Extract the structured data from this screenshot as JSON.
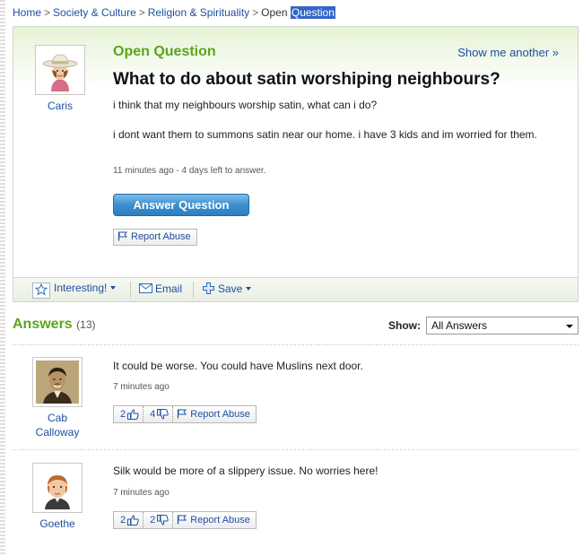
{
  "breadcrumb": {
    "items": [
      "Home",
      "Society & Culture",
      "Religion & Spirituality"
    ],
    "current_prefix": "Open",
    "current_highlight": "Question",
    "separator": ">"
  },
  "question": {
    "label": "Open Question",
    "show_another": "Show me another »",
    "title": "What to do about satin worshiping neighbours?",
    "body_1": "i think that my neighbours worship satin, what can i do?",
    "body_2": "i dont want them to summons satin near our home. i have 3 kids and im worried for them.",
    "meta": "11 minutes ago - 4 days left to answer.",
    "asker": "Caris",
    "answer_button": "Answer Question",
    "report_abuse": "Report Abuse"
  },
  "toolbar": {
    "interesting": "Interesting!",
    "email": "Email",
    "save": "Save"
  },
  "answers": {
    "label": "Answers",
    "count": "(13)",
    "show_label": "Show:",
    "filter_value": "All Answers",
    "items": [
      {
        "user_line1": "Cab",
        "user_line2": "Calloway",
        "text": "It could be worse. You could have Muslins next door.",
        "time": "7 minutes ago",
        "thumbs_up": "2",
        "thumbs_down": "4",
        "report": "Report Abuse"
      },
      {
        "user_line1": "Goethe",
        "text": "Silk would be more of a slippery issue. No worries here!",
        "time": "7 minutes ago",
        "thumbs_up": "2",
        "thumbs_down": "2",
        "report": "Report Abuse"
      }
    ]
  },
  "icons": {
    "flag": "flag-icon",
    "star": "star-icon",
    "email": "envelope-icon",
    "save": "plus-icon",
    "thumbs_up": "thumbs-up-icon",
    "thumbs_down": "thumbs-down-icon"
  },
  "colors": {
    "link": "#1f4fa0",
    "green_heading": "#5aa51a",
    "button_blue": "#3d8fcf",
    "highlight": "#3465c9"
  }
}
